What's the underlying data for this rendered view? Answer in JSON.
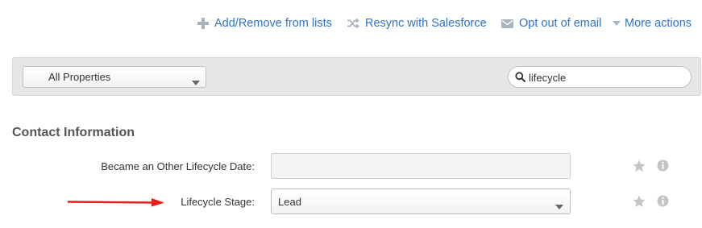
{
  "actions": {
    "add_remove_lists": "Add/Remove from lists",
    "resync_salesforce": "Resync with Salesforce",
    "opt_out_email": "Opt out of email",
    "more_actions": "More actions"
  },
  "filter": {
    "property_select_value": "All Properties",
    "search_value": "lifecycle"
  },
  "section": {
    "title": "Contact Information"
  },
  "fields": [
    {
      "label": "Became an Other Lifecycle Date:",
      "value": ""
    },
    {
      "label": "Lifecycle Stage:",
      "value": "Lead"
    }
  ],
  "icons": {
    "plus": "plus-icon",
    "shuffle": "shuffle-icon",
    "envelope": "envelope-icon",
    "caret": "caret-down-icon",
    "search": "search-icon",
    "star": "star-icon",
    "info": "info-icon",
    "arrow": "red-arrow-annotation"
  },
  "colors": {
    "link": "#2d73c7",
    "toolbar_bg": "#e6e6e6",
    "icon_gray": "#bbbbbb",
    "annotation_arrow": "#e0201b"
  }
}
